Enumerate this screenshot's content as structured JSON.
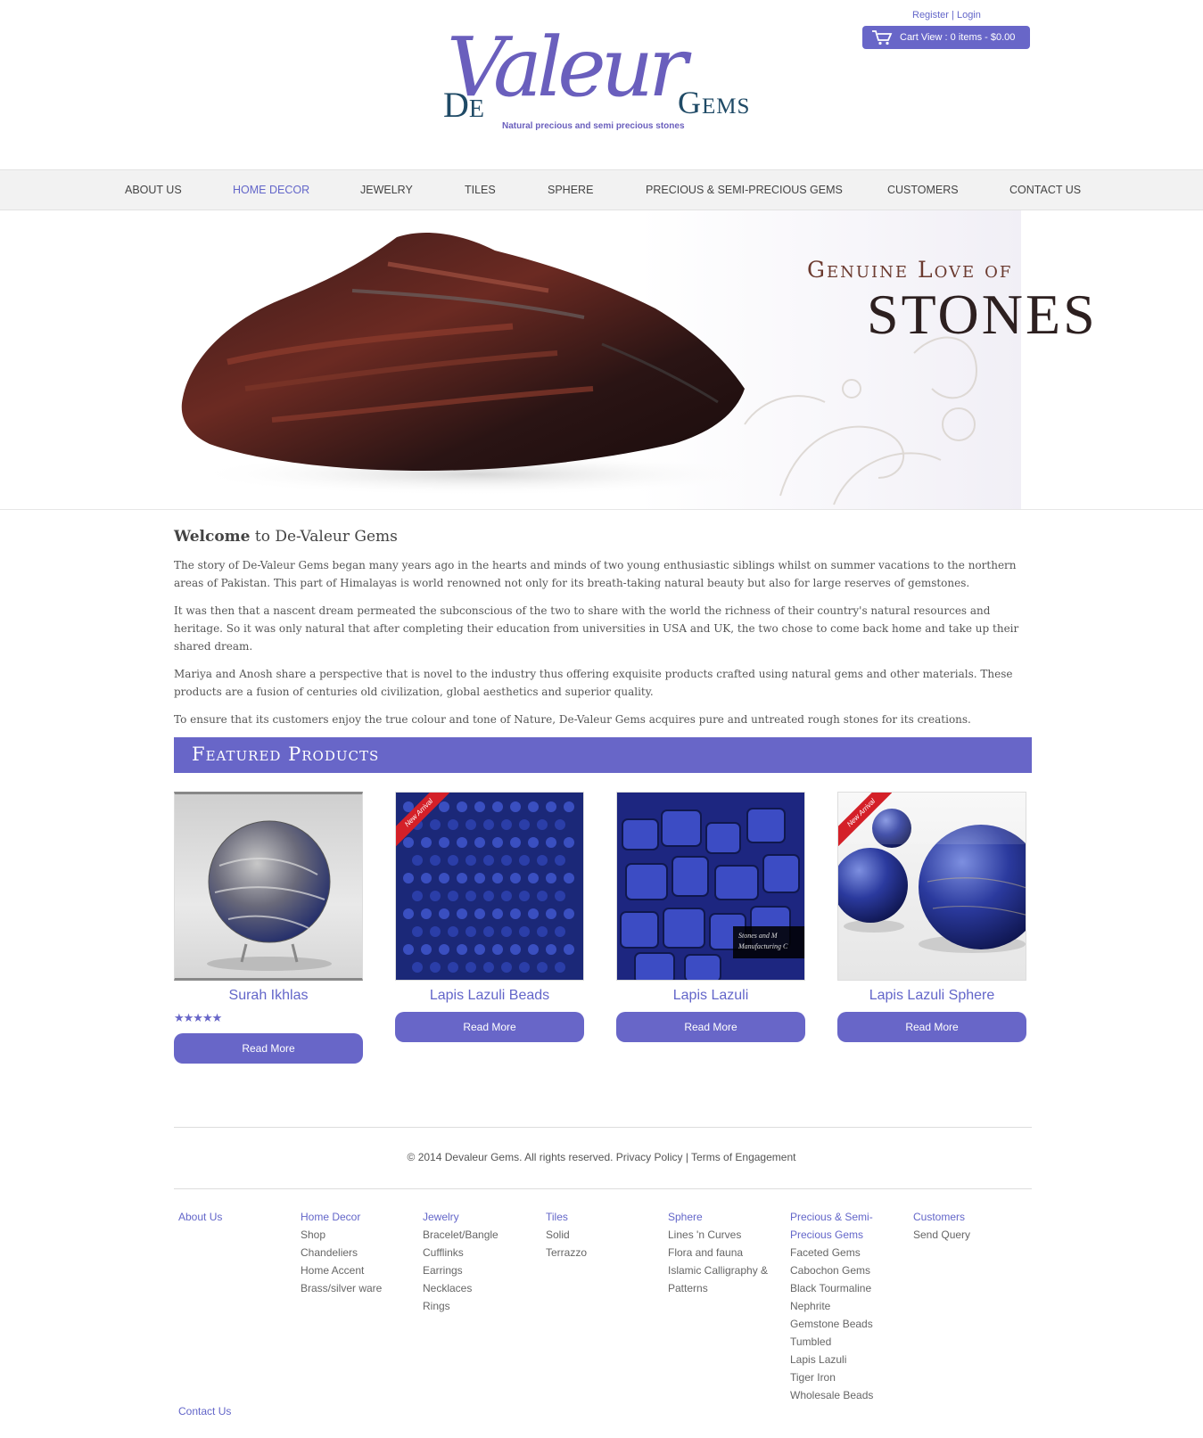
{
  "header": {
    "register": "Register",
    "separator": "|",
    "login": "Login",
    "cart": "Cart View : 0 items - $0.00",
    "logo": {
      "de": "De",
      "valeur": "Valeur",
      "gems": "Gems",
      "tagline": "Natural precious and semi precious stones"
    }
  },
  "nav": {
    "items": [
      {
        "label": "ABOUT US"
      },
      {
        "label": "HOME DECOR"
      },
      {
        "label": "JEWELRY"
      },
      {
        "label": "TILES"
      },
      {
        "label": "SPHERE"
      },
      {
        "label": "PRECIOUS & SEMI-PRECIOUS GEMS"
      },
      {
        "label": "CUSTOMERS"
      },
      {
        "label": "CONTACT US"
      }
    ]
  },
  "banner": {
    "line1": "Genuine Love of",
    "line2": "STONES"
  },
  "welcome": {
    "title_bold": "Welcome",
    "title_rest": " to De-Valeur Gems",
    "paragraphs": [
      "The story of De-Valeur Gems began many years ago in the hearts and minds of two young enthusiastic siblings whilst on summer vacations to the northern areas of Pakistan. This part of Himalayas is world renowned not only for its breath-taking natural beauty but also for large reserves of gemstones.",
      "It was then that a nascent dream  permeated the subconscious of the two to share with the world the richness of their country's natural resources and heritage. So it was only natural that after completing their education from universities in USA and UK, the two chose to come back home and take up their shared dream.",
      "Mariya and Anosh share a perspective that is novel to the industry thus offering exquisite products crafted using natural gems and other materials. These products are a fusion of centuries old civilization, global aesthetics and superior quality.",
      "To ensure that its customers enjoy the true colour and tone of Nature, De-Valeur Gems acquires pure and untreated rough stones for its creations."
    ]
  },
  "featured": {
    "title": "Featured Products",
    "ribbon": "New Arrival",
    "products": [
      {
        "name": "Surah Ikhlas",
        "button": "Read More",
        "stars": "★★★★★",
        "rating": 5
      },
      {
        "name": "Lapis Lazuli Beads",
        "button": "Read More"
      },
      {
        "name": "Lapis Lazuli",
        "button": "Read More",
        "watermark": "Stones and M Manufacturing C"
      },
      {
        "name": "Lapis Lazuli Sphere",
        "button": "Read More"
      }
    ]
  },
  "footer": {
    "copyright": "© 2014 Devaleur Gems. All rights reserved. Privacy Policy | Terms of Engagement",
    "columns": [
      {
        "head": "About Us",
        "items": []
      },
      {
        "head": "Home Decor",
        "items": [
          "Shop",
          "Chandeliers",
          "Home Accent",
          "Brass/silver ware"
        ]
      },
      {
        "head": "Jewelry",
        "items": [
          "Bracelet/Bangle",
          "Cufflinks",
          "Earrings",
          "Necklaces",
          "Rings"
        ]
      },
      {
        "head": "Tiles",
        "items": [
          "Solid",
          "Terrazzo"
        ]
      },
      {
        "head": "Sphere",
        "items": [
          "Lines 'n Curves",
          "Flora and fauna",
          "Islamic Calligraphy &",
          "Patterns"
        ]
      },
      {
        "head": "Precious & Semi-",
        "head2": "Precious Gems",
        "items": [
          "Faceted Gems",
          "Cabochon Gems",
          "Black Tourmaline",
          "Nephrite",
          "Gemstone Beads",
          "Tumbled",
          "Lapis Lazuli",
          "Tiger Iron",
          "Wholesale Beads"
        ]
      },
      {
        "head": "Customers",
        "items": [
          "Send Query"
        ]
      }
    ],
    "contact": "Contact Us"
  }
}
